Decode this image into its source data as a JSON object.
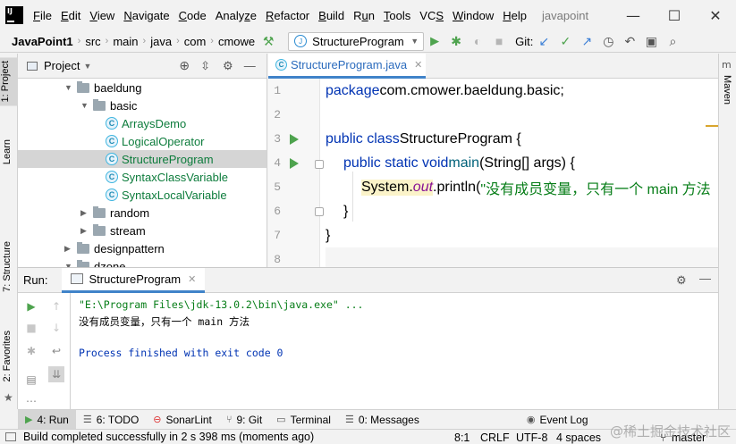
{
  "menubar": {
    "items": [
      "File",
      "Edit",
      "View",
      "Navigate",
      "Code",
      "Analyze",
      "Refactor",
      "Build",
      "Run",
      "Tools",
      "VCS",
      "Window",
      "Help"
    ],
    "mnemonics": [
      "F",
      "E",
      "V",
      "N",
      "C",
      "z",
      "R",
      "B",
      "u",
      "T",
      "S",
      "W",
      "H"
    ],
    "project_title": "javapoint"
  },
  "window_controls": {
    "minimize": "—",
    "maximize": "☐",
    "close": "✕"
  },
  "navbar": {
    "breadcrumbs": [
      "JavaPoint1",
      "src",
      "main",
      "java",
      "com",
      "cmowe"
    ],
    "run_config": "StructureProgram",
    "git_label": "Git:"
  },
  "left_strip": {
    "tabs": [
      "1: Project",
      "Learn",
      "7: Structure",
      "2: Favorites"
    ]
  },
  "right_strip": {
    "tabs": [
      "Maven"
    ]
  },
  "project_panel": {
    "title": "Project",
    "tree": [
      {
        "label": "baeldung",
        "type": "folder",
        "expanded": true,
        "depth": 4
      },
      {
        "label": "basic",
        "type": "folder",
        "expanded": true,
        "depth": 5
      },
      {
        "label": "ArraysDemo",
        "type": "class",
        "depth": 6
      },
      {
        "label": "LogicalOperator",
        "type": "class",
        "depth": 6
      },
      {
        "label": "StructureProgram",
        "type": "class",
        "depth": 6,
        "selected": true
      },
      {
        "label": "SyntaxClassVariable",
        "type": "class",
        "depth": 6
      },
      {
        "label": "SyntaxLocalVariable",
        "type": "class",
        "depth": 6
      },
      {
        "label": "random",
        "type": "folder",
        "expanded": false,
        "depth": 5
      },
      {
        "label": "stream",
        "type": "folder",
        "expanded": false,
        "depth": 5
      },
      {
        "label": "designpattern",
        "type": "folder",
        "expanded": false,
        "depth": 4
      },
      {
        "label": "dzone",
        "type": "folder",
        "expanded": true,
        "depth": 4
      }
    ]
  },
  "editor": {
    "tab_label": "StructureProgram.java",
    "line_numbers": [
      "1",
      "2",
      "3",
      "4",
      "5",
      "6",
      "7",
      "8"
    ],
    "code": {
      "l1_kw": "package",
      "l1_rest": " com.cmower.baeldung.basic;",
      "l3_kw": "public class",
      "l3_rest": " StructureProgram {",
      "l4_kw": "public static void",
      "l4_name": " main",
      "l4_rest": "(String[] args) {",
      "l5_sys": "System.",
      "l5_out": "out",
      "l5_call": ".println(",
      "l5_str": "\"没有成员变量，只有一个 main 方法",
      "l6": "}",
      "l7": "}"
    }
  },
  "run_panel": {
    "label": "Run:",
    "tab_label": "StructureProgram",
    "console": [
      {
        "text": "\"E:\\Program Files\\jdk-13.0.2\\bin\\java.exe\" ...",
        "color": "#067d17"
      },
      {
        "text": "没有成员变量，只有一个 main 方法",
        "color": "#000000"
      },
      {
        "text": "",
        "color": "#000000"
      },
      {
        "text": "Process finished with exit code 0",
        "color": "#0033b3"
      }
    ]
  },
  "bottom_tabs": [
    {
      "label": "4: Run",
      "icon": "run-icon",
      "active": true
    },
    {
      "label": "6: TODO",
      "icon": "todo-icon"
    },
    {
      "label": "SonarLint",
      "icon": "sonarlint-icon"
    },
    {
      "label": "9: Git",
      "icon": "git-icon"
    },
    {
      "label": "Terminal",
      "icon": "terminal-icon"
    },
    {
      "label": "0: Messages",
      "icon": "messages-icon"
    },
    {
      "label": "Event Log",
      "icon": "event-log-icon"
    }
  ],
  "status_bar": {
    "message": "Build completed successfully in 2 s 398 ms (moments ago)",
    "position": "8:1",
    "line_sep": "CRLF",
    "encoding": "UTF-8",
    "indent": "4 spaces",
    "branch": "master"
  },
  "watermark": "@稀土掘金技术社区",
  "colors": {
    "accent": "#4083c9",
    "run_green": "#4ea34e",
    "keyword": "#0033b3",
    "string": "#067d17",
    "class_label": "#0d7c3c"
  }
}
